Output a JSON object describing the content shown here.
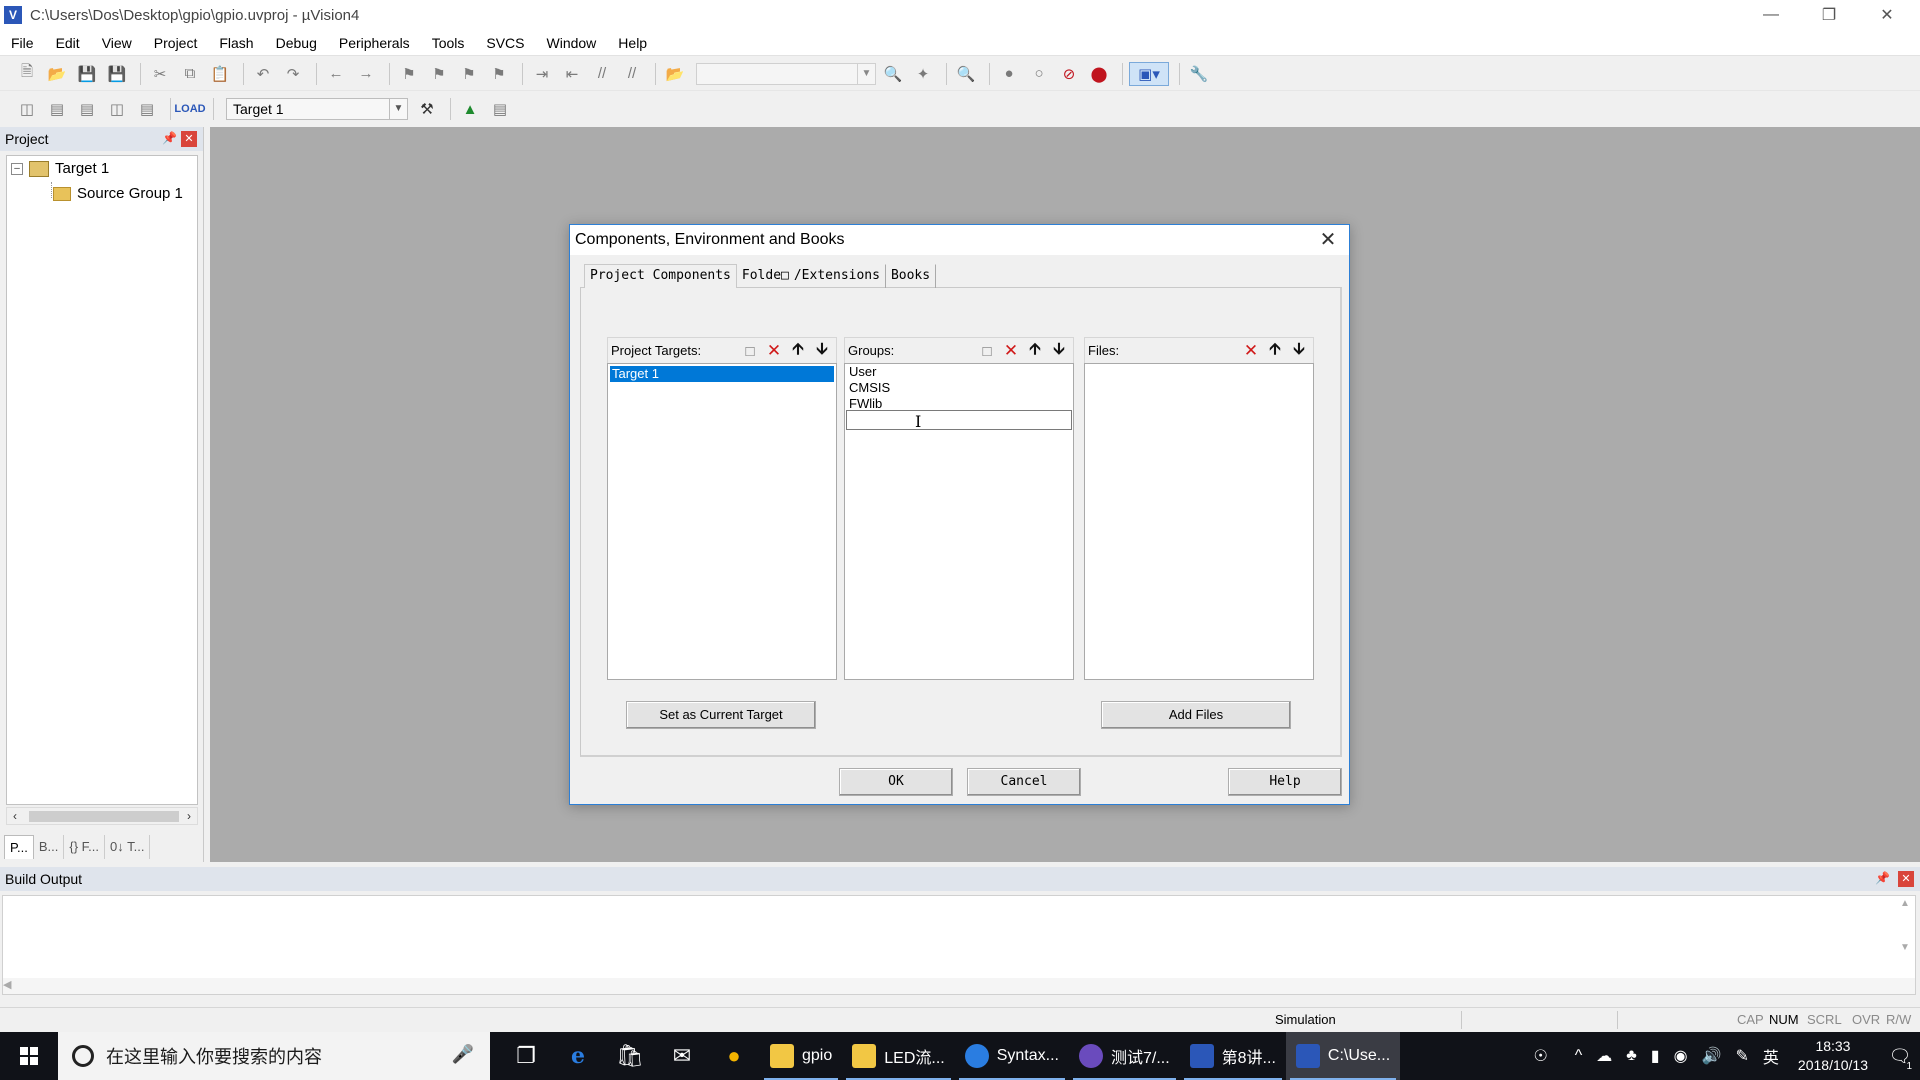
{
  "window": {
    "title": "C:\\Users\\Dos\\Desktop\\gpio\\gpio.uvproj - µVision4",
    "app_icon": "V"
  },
  "menu": [
    "File",
    "Edit",
    "View",
    "Project",
    "Flash",
    "Debug",
    "Peripherals",
    "Tools",
    "SVCS",
    "Window",
    "Help"
  ],
  "toolbar2": {
    "target_select": "Target 1"
  },
  "project_panel": {
    "title": "Project",
    "tree": {
      "root": "Target 1",
      "child": "Source Group 1"
    },
    "tabs": [
      "P...",
      "B...",
      "{} F...",
      "0↓ T..."
    ]
  },
  "build_output": {
    "title": "Build Output"
  },
  "statusbar": {
    "simulation": "Simulation",
    "indicators": [
      "CAP",
      "NUM",
      "SCRL",
      "OVR",
      "R/W"
    ],
    "active_indicator": "NUM"
  },
  "dialog": {
    "title": "Components, Environment and Books",
    "tabs": [
      "Project Components",
      "Folde",
      "/Extensions",
      "Books"
    ],
    "project_targets": {
      "label": "Project Targets:",
      "items": [
        "Target 1"
      ],
      "selected": "Target 1"
    },
    "groups": {
      "label": "Groups:",
      "items": [
        "User",
        "CMSIS",
        "FWlib"
      ],
      "edit_value": ""
    },
    "files": {
      "label": "Files:",
      "items": []
    },
    "set_current_target_label": "Set as Current Target",
    "add_files_label": "Add Files",
    "ok_label": "OK",
    "cancel_label": "Cancel",
    "help_label": "Help"
  },
  "taskbar": {
    "search_placeholder": "在这里输入你要搜索的内容",
    "apps": [
      {
        "label": "gpio",
        "icon": "folder-icon",
        "color": "#f2c744"
      },
      {
        "label": "LED流...",
        "icon": "folder-icon",
        "color": "#f2c744"
      },
      {
        "label": "Syntax...",
        "icon": "browser-icon",
        "color": "#2a7de1"
      },
      {
        "label": "测试7/...",
        "icon": "editor-icon",
        "color": "#6a4bbd"
      },
      {
        "label": "第8讲...",
        "icon": "word-icon",
        "color": "#2b57b8"
      },
      {
        "label": "C:\\Use...",
        "icon": "uvision-icon",
        "color": "#2b57b8"
      }
    ],
    "ime": "英",
    "time": "18:33",
    "date": "2018/10/13",
    "notifications": "1"
  }
}
